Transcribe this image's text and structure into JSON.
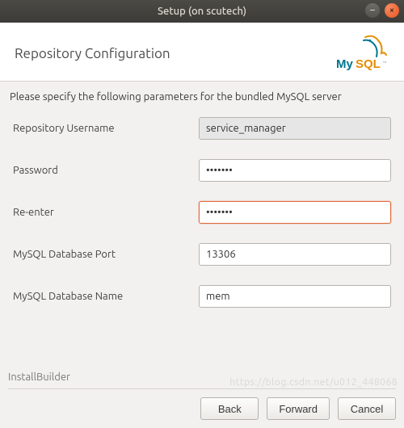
{
  "titlebar": {
    "title": "Setup (on scutech)"
  },
  "header": {
    "title": "Repository Configuration",
    "logo_text": "MySQL"
  },
  "instruction": "Please specify the following parameters for the bundled MySQL server",
  "form": {
    "username_label": "Repository Username",
    "username_value": "service_manager",
    "password_label": "Password",
    "password_value": "•••••••",
    "reenter_label": "Re-enter",
    "reenter_value": "•••••••",
    "port_label": "MySQL Database Port",
    "port_value": "13306",
    "dbname_label": "MySQL Database Name",
    "dbname_value": "mem"
  },
  "footer": {
    "builder": "InstallBuilder"
  },
  "buttons": {
    "back": "Back",
    "forward": "Forward",
    "cancel": "Cancel"
  },
  "watermark": "https://blog.csdn.net/u012_448068"
}
